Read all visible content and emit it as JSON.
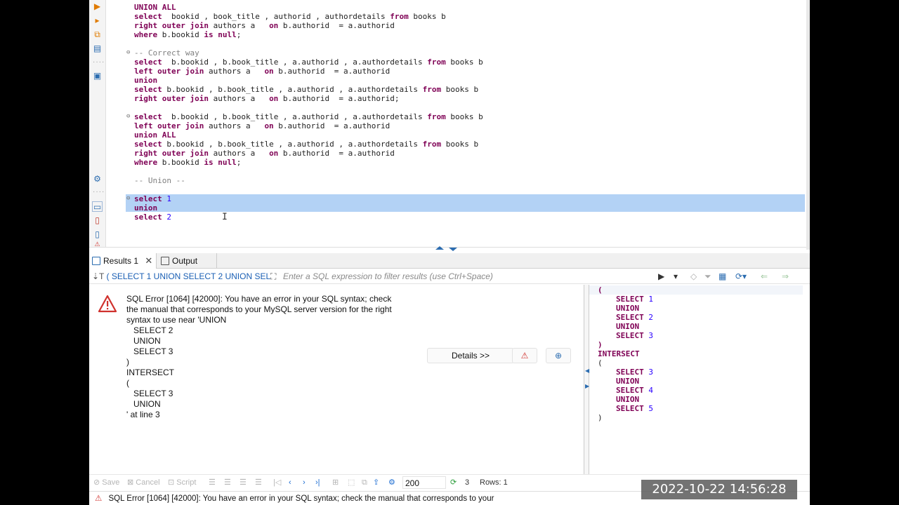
{
  "editor": {
    "lines": [
      {
        "segments": [
          {
            "t": "UNION ALL",
            "c": "kw"
          }
        ]
      },
      {
        "segments": [
          {
            "t": "select",
            "c": "kw"
          },
          {
            "t": "  bookid , book_title , authorid , authordetails "
          },
          {
            "t": "from",
            "c": "kw"
          },
          {
            "t": " books b"
          }
        ]
      },
      {
        "segments": [
          {
            "t": "right outer join",
            "c": "kw"
          },
          {
            "t": " authors a   "
          },
          {
            "t": "on",
            "c": "kw"
          },
          {
            "t": " b.authorid  = a.authorid"
          }
        ]
      },
      {
        "segments": [
          {
            "t": "where",
            "c": "kw"
          },
          {
            "t": " b.bookid "
          },
          {
            "t": "is null",
            "c": "kw"
          },
          {
            "t": ";"
          }
        ]
      },
      {
        "segments": []
      },
      {
        "segments": [
          {
            "t": "-- Correct way",
            "c": "cm"
          }
        ],
        "fold": true
      },
      {
        "segments": [
          {
            "t": "select",
            "c": "kw"
          },
          {
            "t": "  b.bookid , b.book_title , a.authorid , a.authordetails "
          },
          {
            "t": "from",
            "c": "kw"
          },
          {
            "t": " books b"
          }
        ]
      },
      {
        "segments": [
          {
            "t": "left outer join",
            "c": "kw"
          },
          {
            "t": " authors a   "
          },
          {
            "t": "on",
            "c": "kw"
          },
          {
            "t": " b.authorid  = a.authorid"
          }
        ]
      },
      {
        "segments": [
          {
            "t": "union",
            "c": "kw"
          }
        ]
      },
      {
        "segments": [
          {
            "t": "select",
            "c": "kw"
          },
          {
            "t": " b.bookid , b.book_title , a.authorid , a.authordetails "
          },
          {
            "t": "from",
            "c": "kw"
          },
          {
            "t": " books b"
          }
        ]
      },
      {
        "segments": [
          {
            "t": "right outer join",
            "c": "kw"
          },
          {
            "t": " authors a   "
          },
          {
            "t": "on",
            "c": "kw"
          },
          {
            "t": " b.authorid  = a.authorid;"
          }
        ]
      },
      {
        "segments": []
      },
      {
        "segments": [
          {
            "t": "select",
            "c": "kw"
          },
          {
            "t": "  b.bookid , b.book_title , a.authorid , a.authordetails "
          },
          {
            "t": "from",
            "c": "kw"
          },
          {
            "t": " books b"
          }
        ],
        "fold": true
      },
      {
        "segments": [
          {
            "t": "left outer join",
            "c": "kw"
          },
          {
            "t": " authors a   "
          },
          {
            "t": "on",
            "c": "kw"
          },
          {
            "t": " b.authorid  = a.authorid"
          }
        ]
      },
      {
        "segments": [
          {
            "t": "union ALL",
            "c": "kw"
          }
        ]
      },
      {
        "segments": [
          {
            "t": "select",
            "c": "kw"
          },
          {
            "t": " b.bookid , b.book_title , a.authorid , a.authordetails "
          },
          {
            "t": "from",
            "c": "kw"
          },
          {
            "t": " books b"
          }
        ]
      },
      {
        "segments": [
          {
            "t": "right outer join",
            "c": "kw"
          },
          {
            "t": " authors a   "
          },
          {
            "t": "on",
            "c": "kw"
          },
          {
            "t": " b.authorid  = a.authorid"
          }
        ]
      },
      {
        "segments": [
          {
            "t": "where",
            "c": "kw"
          },
          {
            "t": " b.bookid "
          },
          {
            "t": "is null",
            "c": "kw"
          },
          {
            "t": ";"
          }
        ]
      },
      {
        "segments": []
      },
      {
        "segments": [
          {
            "t": "-- Union --",
            "c": "cm"
          }
        ]
      },
      {
        "segments": []
      },
      {
        "segments": [
          {
            "t": "select",
            "c": "kw"
          },
          {
            "t": " "
          },
          {
            "t": "1",
            "c": "num"
          }
        ],
        "fold": true
      },
      {
        "segments": [
          {
            "t": "union",
            "c": "kw"
          }
        ]
      },
      {
        "segments": [
          {
            "t": "select",
            "c": "kw"
          },
          {
            "t": " "
          },
          {
            "t": "2",
            "c": "num"
          }
        ]
      }
    ]
  },
  "tabs": {
    "results_label": "Results 1",
    "output_label": "Output"
  },
  "filter": {
    "query_label": "( SELECT 1 UNION SELECT 2 UNION SEL",
    "placeholder": "Enter a SQL expression to filter results (use Ctrl+Space)"
  },
  "error": {
    "message": "SQL Error [1064] [42000]: You have an error in your SQL syntax; check\nthe manual that corresponds to your MySQL server version for the right\nsyntax to use near 'UNION\n   SELECT 2\n   UNION\n   SELECT 3\n)\nINTERSECT\n(\n   SELECT 3\n   UNION\n' at line 3",
    "details_label": "Details >>"
  },
  "query_panel": {
    "lines": [
      {
        "indent": 0,
        "segments": [
          {
            "t": "(",
            "c": "kw"
          }
        ]
      },
      {
        "indent": 1,
        "segments": [
          {
            "t": "SELECT",
            "c": "kw"
          },
          {
            "t": " "
          },
          {
            "t": "1",
            "c": "num"
          }
        ]
      },
      {
        "indent": 1,
        "segments": [
          {
            "t": "UNION",
            "c": "kw"
          }
        ]
      },
      {
        "indent": 1,
        "segments": [
          {
            "t": "SELECT",
            "c": "kw"
          },
          {
            "t": " "
          },
          {
            "t": "2",
            "c": "num"
          }
        ]
      },
      {
        "indent": 1,
        "segments": [
          {
            "t": "UNION",
            "c": "kw"
          }
        ]
      },
      {
        "indent": 1,
        "segments": [
          {
            "t": "SELECT",
            "c": "kw"
          },
          {
            "t": " "
          },
          {
            "t": "3",
            "c": "num"
          }
        ]
      },
      {
        "indent": 0,
        "segments": [
          {
            "t": ")",
            "c": "kw"
          }
        ]
      },
      {
        "indent": 0,
        "segments": [
          {
            "t": "INTERSECT",
            "c": "kw"
          }
        ]
      },
      {
        "indent": 0,
        "segments": [
          {
            "t": "("
          }
        ]
      },
      {
        "indent": 1,
        "segments": [
          {
            "t": "SELECT",
            "c": "kw"
          },
          {
            "t": " "
          },
          {
            "t": "3",
            "c": "num"
          }
        ]
      },
      {
        "indent": 1,
        "segments": [
          {
            "t": "UNION",
            "c": "kw"
          }
        ]
      },
      {
        "indent": 1,
        "segments": [
          {
            "t": "SELECT",
            "c": "kw"
          },
          {
            "t": " "
          },
          {
            "t": "4",
            "c": "num"
          }
        ]
      },
      {
        "indent": 1,
        "segments": [
          {
            "t": "UNION",
            "c": "kw"
          }
        ]
      },
      {
        "indent": 1,
        "segments": [
          {
            "t": "SELECT",
            "c": "kw"
          },
          {
            "t": " "
          },
          {
            "t": "5",
            "c": "num"
          }
        ]
      },
      {
        "indent": 0,
        "segments": [
          {
            "t": ")"
          }
        ]
      }
    ]
  },
  "toolbar": {
    "save_label": "Save",
    "cancel_label": "Cancel",
    "script_label": "Script",
    "page_size": "200",
    "refresh_count": "3",
    "rows_label": "Rows: 1"
  },
  "status": {
    "message": "SQL Error [1064] [42000]: You have an error in your SQL syntax; check the manual that corresponds to your"
  },
  "overlay": {
    "timestamp": "2022-10-22  14:56:28"
  },
  "colors": {
    "keyword": "#7f0055",
    "number": "#2a00ff",
    "comment": "#808080",
    "selection": "#b3d2f5",
    "error_red": "#d0312d"
  }
}
